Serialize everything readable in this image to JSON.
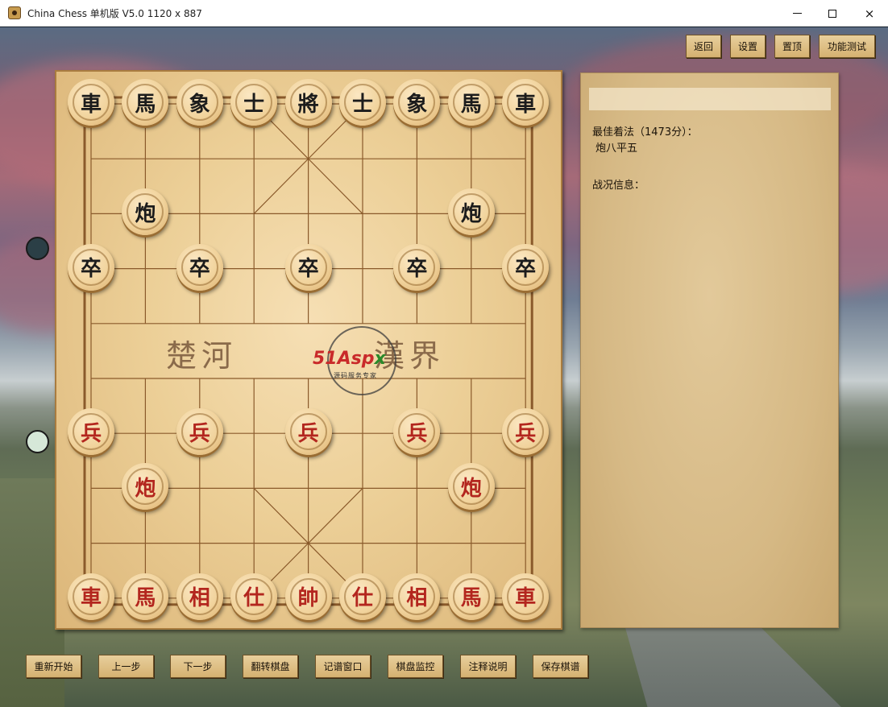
{
  "window": {
    "title": "China Chess 单机版 V5.0  1120 x 887",
    "controls": {
      "minimize": "minimize-icon",
      "maximize": "maximize-icon",
      "close": "×"
    }
  },
  "toolbar_top": [
    {
      "id": "back",
      "label": "返回"
    },
    {
      "id": "settings",
      "label": "设置"
    },
    {
      "id": "pin",
      "label": "置顶"
    },
    {
      "id": "test",
      "label": "功能测试"
    }
  ],
  "toolbar_bottom": [
    {
      "id": "restart",
      "label": "重新开始"
    },
    {
      "id": "prev",
      "label": "上一步"
    },
    {
      "id": "next",
      "label": "下一步"
    },
    {
      "id": "flip",
      "label": "翻转棋盘"
    },
    {
      "id": "record",
      "label": "记谱窗口"
    },
    {
      "id": "monitor",
      "label": "棋盘监控"
    },
    {
      "id": "help",
      "label": "注释说明"
    },
    {
      "id": "save",
      "label": "保存棋谱"
    }
  ],
  "board": {
    "river_left": "楚河",
    "river_right": "漢界",
    "watermark": {
      "main": "51Asp",
      "accent": "x",
      "sub": "源码服务专家"
    },
    "pieces": [
      {
        "side": "black",
        "char": "車",
        "col": 0,
        "row": 0
      },
      {
        "side": "black",
        "char": "馬",
        "col": 1,
        "row": 0
      },
      {
        "side": "black",
        "char": "象",
        "col": 2,
        "row": 0
      },
      {
        "side": "black",
        "char": "士",
        "col": 3,
        "row": 0
      },
      {
        "side": "black",
        "char": "將",
        "col": 4,
        "row": 0
      },
      {
        "side": "black",
        "char": "士",
        "col": 5,
        "row": 0
      },
      {
        "side": "black",
        "char": "象",
        "col": 6,
        "row": 0
      },
      {
        "side": "black",
        "char": "馬",
        "col": 7,
        "row": 0
      },
      {
        "side": "black",
        "char": "車",
        "col": 8,
        "row": 0
      },
      {
        "side": "black",
        "char": "炮",
        "col": 1,
        "row": 2
      },
      {
        "side": "black",
        "char": "炮",
        "col": 7,
        "row": 2
      },
      {
        "side": "black",
        "char": "卒",
        "col": 0,
        "row": 3
      },
      {
        "side": "black",
        "char": "卒",
        "col": 2,
        "row": 3
      },
      {
        "side": "black",
        "char": "卒",
        "col": 4,
        "row": 3
      },
      {
        "side": "black",
        "char": "卒",
        "col": 6,
        "row": 3
      },
      {
        "side": "black",
        "char": "卒",
        "col": 8,
        "row": 3
      },
      {
        "side": "red",
        "char": "兵",
        "col": 0,
        "row": 6
      },
      {
        "side": "red",
        "char": "兵",
        "col": 2,
        "row": 6
      },
      {
        "side": "red",
        "char": "兵",
        "col": 4,
        "row": 6
      },
      {
        "side": "red",
        "char": "兵",
        "col": 6,
        "row": 6
      },
      {
        "side": "red",
        "char": "兵",
        "col": 8,
        "row": 6
      },
      {
        "side": "red",
        "char": "炮",
        "col": 1,
        "row": 7
      },
      {
        "side": "red",
        "char": "炮",
        "col": 7,
        "row": 7
      },
      {
        "side": "red",
        "char": "車",
        "col": 0,
        "row": 9
      },
      {
        "side": "red",
        "char": "馬",
        "col": 1,
        "row": 9
      },
      {
        "side": "red",
        "char": "相",
        "col": 2,
        "row": 9
      },
      {
        "side": "red",
        "char": "仕",
        "col": 3,
        "row": 9
      },
      {
        "side": "red",
        "char": "帥",
        "col": 4,
        "row": 9
      },
      {
        "side": "red",
        "char": "仕",
        "col": 5,
        "row": 9
      },
      {
        "side": "red",
        "char": "相",
        "col": 6,
        "row": 9
      },
      {
        "side": "red",
        "char": "馬",
        "col": 7,
        "row": 9
      },
      {
        "side": "red",
        "char": "車",
        "col": 8,
        "row": 9
      }
    ]
  },
  "side_markers": {
    "top_color": "#2b3f46",
    "bottom_color": "#d6e8d8"
  },
  "panel": {
    "input_value": "",
    "best_move_label": "最佳着法（1473分）：",
    "best_move": "炮八平五",
    "status_label": "战况信息："
  },
  "colors": {
    "button_bg": "#dcbc7e",
    "red_piece_text": "#b3261e",
    "black_piece_text": "#1c1c1c"
  }
}
